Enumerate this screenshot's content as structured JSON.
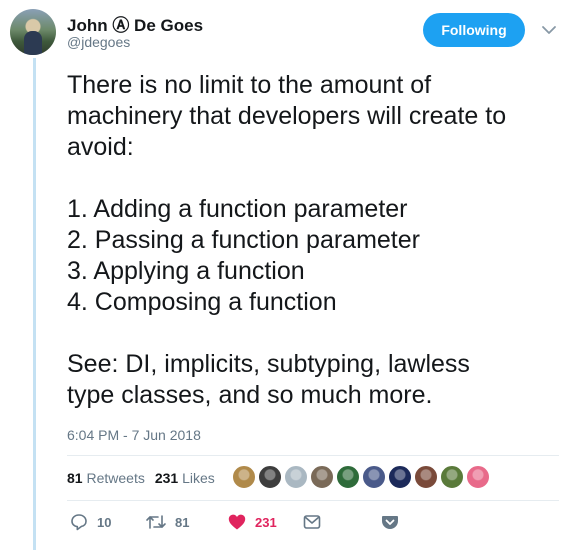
{
  "author": {
    "name": "John Ⓐ De Goes",
    "handle": "@jdegoes"
  },
  "follow_button": {
    "label": "Following"
  },
  "tweet": {
    "lines": [
      "There is no limit to the amount of",
      "machinery that developers will create to",
      "avoid:",
      "",
      "1. Adding a function parameter",
      "2. Passing a function parameter",
      "3. Applying a function",
      "4. Composing a function",
      "",
      "See: DI, implicits, subtyping, lawless",
      "type classes, and so much more."
    ],
    "timestamp": "6:04 PM - 7 Jun 2018"
  },
  "stats": {
    "retweets_count": "81",
    "retweets_label": "Retweets",
    "likes_count": "231",
    "likes_label": "Likes"
  },
  "likers": [
    {
      "color": "#b08a4a"
    },
    {
      "color": "#3d3d3d"
    },
    {
      "color": "#aab8c2"
    },
    {
      "color": "#7a6a58"
    },
    {
      "color": "#2e6b3a"
    },
    {
      "color": "#4a5a8a"
    },
    {
      "color": "#1c2a5a"
    },
    {
      "color": "#7a4a3a"
    },
    {
      "color": "#5a7a3a"
    },
    {
      "color": "#e86a8a"
    }
  ],
  "actions": {
    "reply_count": "10",
    "retweet_count": "81",
    "like_count": "231"
  },
  "colors": {
    "accent": "#1da1f2",
    "like": "#e0245e",
    "muted": "#657786",
    "thread": "#c4e1f3"
  }
}
